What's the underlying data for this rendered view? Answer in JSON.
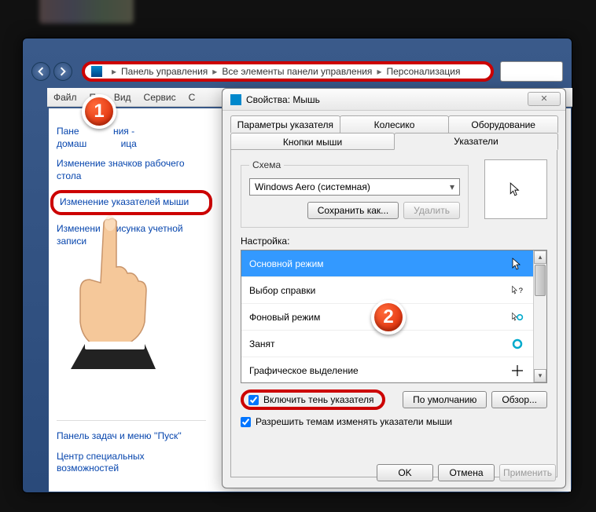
{
  "breadcrumb": {
    "items": [
      "Панель управления",
      "Все элементы панели управления",
      "Персонализация"
    ]
  },
  "menu": {
    "items": [
      "Файл",
      "Пр",
      "Вид",
      "Сервис",
      "С"
    ]
  },
  "sidebar": {
    "links": {
      "0": "Пане             ния - домаш             ица",
      "1": "Изменение значков рабочего стола",
      "2": "Изменение указателей мыши",
      "3": "Изменени      исунка учетной записи",
      "4": "Панель задач и меню ''Пуск''",
      "5": "Центр специальных возможностей"
    }
  },
  "dialog": {
    "title": "Свойства: Мышь",
    "tabs": {
      "row1": [
        "Параметры указателя",
        "Колесико",
        "Оборудование"
      ],
      "row2": [
        "Кнопки мыши",
        "Указатели"
      ]
    },
    "scheme": {
      "legend": "Схема",
      "value": "Windows Aero (системная)",
      "save": "Сохранить как...",
      "delete": "Удалить"
    },
    "settings_label": "Настройка:",
    "cursors": {
      "0": "Основной режим",
      "1": "Выбор справки",
      "2": "Фоновый режим",
      "3": "Занят",
      "4": "Графическое выделение"
    },
    "check_shadow": "Включить тень указателя",
    "check_themes": "Разрешить темам изменять указатели мыши",
    "defaults": "По умолчанию",
    "browse": "Обзор...",
    "ok": "OK",
    "cancel": "Отмена",
    "apply": "Применить"
  },
  "callouts": {
    "1": "1",
    "2": "2"
  }
}
